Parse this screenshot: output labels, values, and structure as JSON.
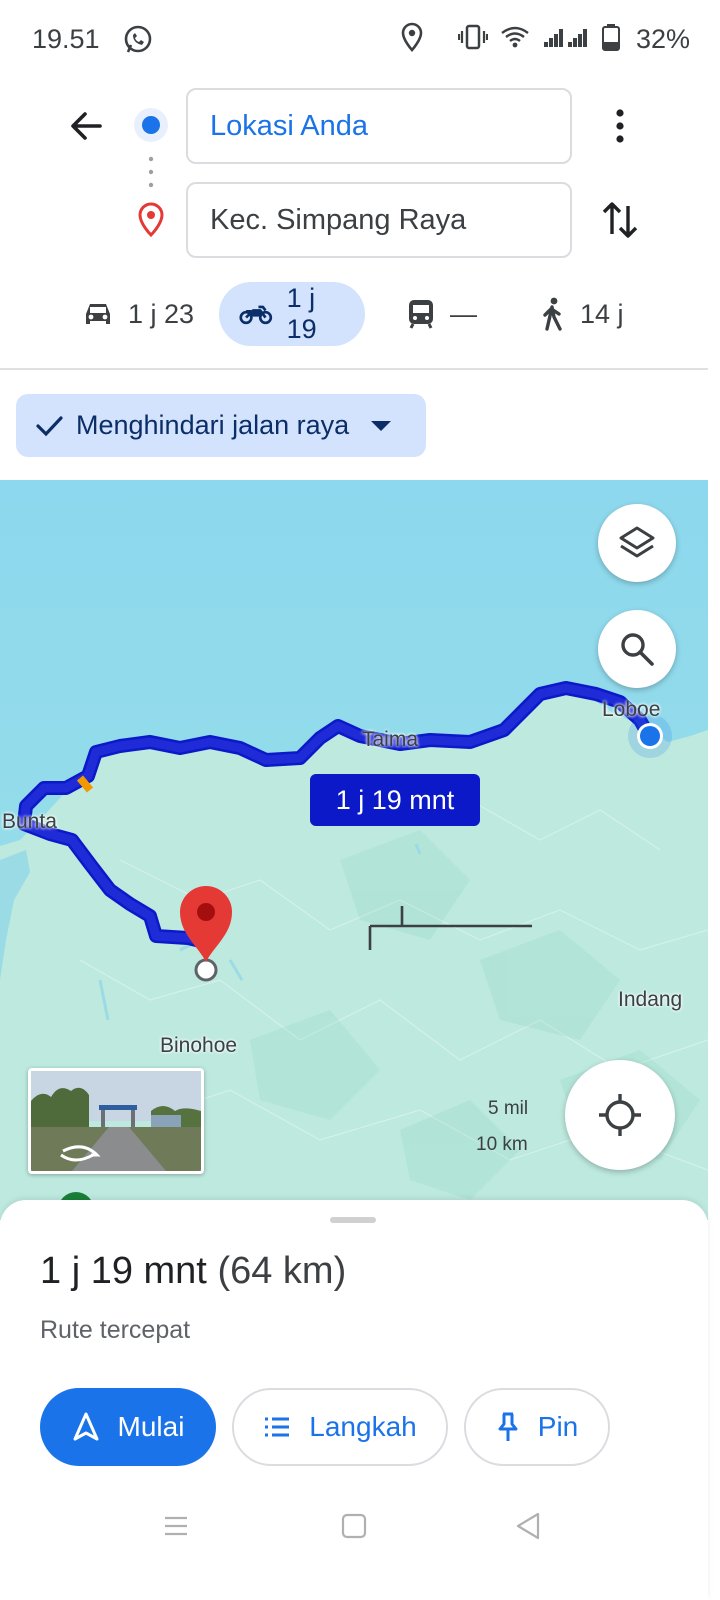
{
  "status_bar": {
    "time": "19.51",
    "battery": "32%"
  },
  "directions": {
    "origin": "Lokasi Anda",
    "destination": "Kec. Simpang Raya"
  },
  "modes": [
    {
      "icon": "car-icon",
      "label": "1 j 23",
      "active": false
    },
    {
      "icon": "motorcycle-icon",
      "label": "1 j 19",
      "active": true
    },
    {
      "icon": "transit-icon",
      "label": "—",
      "active": false
    },
    {
      "icon": "walk-icon",
      "label": "14 j",
      "active": false
    }
  ],
  "filter_chip": {
    "label": "Menghindari jalan raya"
  },
  "map": {
    "labels": {
      "loboe": "Loboe",
      "taima": "Taima",
      "bunta": "Bunta",
      "indang": "Indang",
      "binohoe": "Binohoe"
    },
    "route_bubble": "1 j 19 mnt",
    "scale": {
      "imperial": "5 mil",
      "metric": "10 km"
    }
  },
  "sheet": {
    "duration": "1 j 19 mnt",
    "distance": "(64 km)",
    "subtitle": "Rute tercepat",
    "buttons": {
      "start": "Mulai",
      "steps": "Langkah",
      "pin": "Pin"
    }
  },
  "colors": {
    "accent": "#1a73e8",
    "route": "#1f2bd6",
    "sea": "#8fd9ec",
    "land": "#bde9df",
    "destination_pin": "#e53935"
  }
}
